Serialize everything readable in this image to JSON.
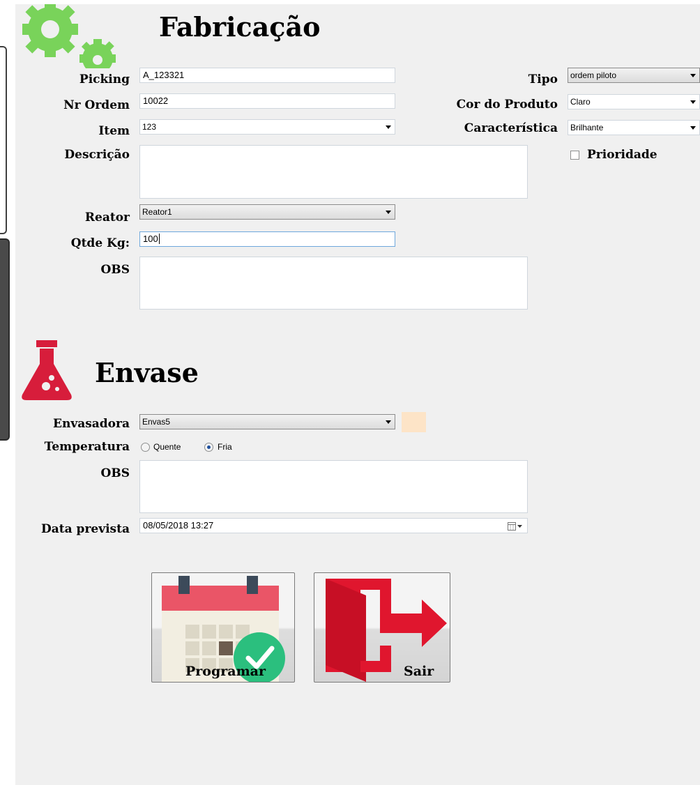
{
  "fabricacao": {
    "title": "Fabricação",
    "picking": {
      "label": "Picking",
      "value": "A_123321"
    },
    "nr_ordem": {
      "label": "Nr Ordem",
      "value": "10022"
    },
    "item": {
      "label": "Item",
      "value": "123"
    },
    "descricao": {
      "label": "Descrição",
      "value": ""
    },
    "reator": {
      "label": "Reator",
      "value": "Reator1"
    },
    "qtde_kg": {
      "label": "Qtde Kg:",
      "value": "100"
    },
    "obs": {
      "label": "OBS",
      "value": ""
    },
    "tipo": {
      "label": "Tipo",
      "value": "ordem piloto"
    },
    "cor_produto": {
      "label": "Cor do Produto",
      "value": "Claro"
    },
    "caracteristica": {
      "label": "Característica",
      "value": "Brilhante"
    },
    "prioridade": {
      "label": "Prioridade",
      "checked": false
    }
  },
  "envase": {
    "title": "Envase",
    "envasadora": {
      "label": "Envasadora",
      "value": "Envas5",
      "swatch_color": "#fde4c7"
    },
    "temperatura": {
      "label": "Temperatura",
      "options": [
        "Quente",
        "Fria"
      ],
      "selected": "Fria"
    },
    "obs": {
      "label": "OBS",
      "value": ""
    },
    "data_prevista": {
      "label": "Data prevista",
      "value": "08/05/2018 13:27"
    }
  },
  "buttons": {
    "programar": "Programar",
    "sair": "Sair"
  },
  "icons": {
    "gear": "gear-icon",
    "flask": "flask-icon",
    "calendar": "calendar-check-icon",
    "exit": "exit-door-icon"
  },
  "colors": {
    "gear_green": "#79d35a",
    "flask_red": "#d71d3b",
    "exit_red": "#e0162e",
    "check_green": "#2bbf7e",
    "calendar_top": "#ea5567"
  }
}
